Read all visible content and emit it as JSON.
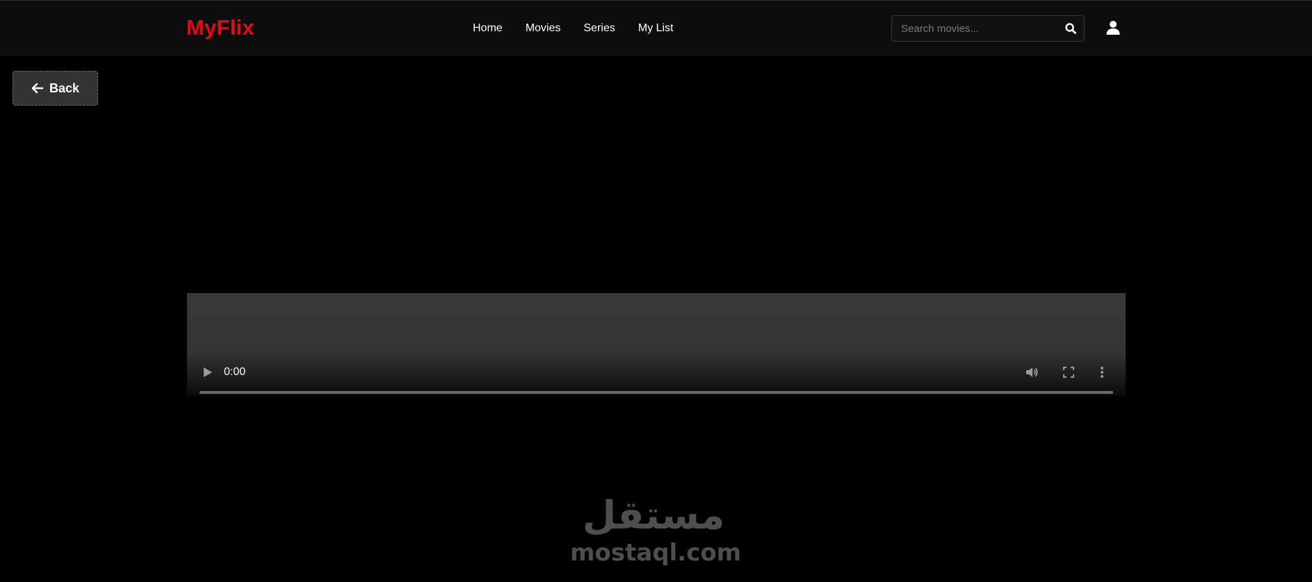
{
  "header": {
    "logo": "MyFlix",
    "nav": [
      {
        "label": "Home"
      },
      {
        "label": "Movies"
      },
      {
        "label": "Series"
      },
      {
        "label": "My List"
      }
    ],
    "search": {
      "placeholder": "Search movies...",
      "value": "",
      "icon": "search-icon"
    },
    "user_icon": "user-icon"
  },
  "back_button": {
    "label": "Back",
    "icon": "arrow-left-icon"
  },
  "video": {
    "current_time": "0:00",
    "progress": 0,
    "controls": [
      "play-icon",
      "volume-icon",
      "fullscreen-icon",
      "more-icon"
    ]
  },
  "watermark": {
    "arabic": "مستقل",
    "latin": "mostaql.com"
  },
  "colors": {
    "brand": "#e50914",
    "background": "#000000",
    "navbar": "#0d0d0d",
    "button": "#333333"
  }
}
